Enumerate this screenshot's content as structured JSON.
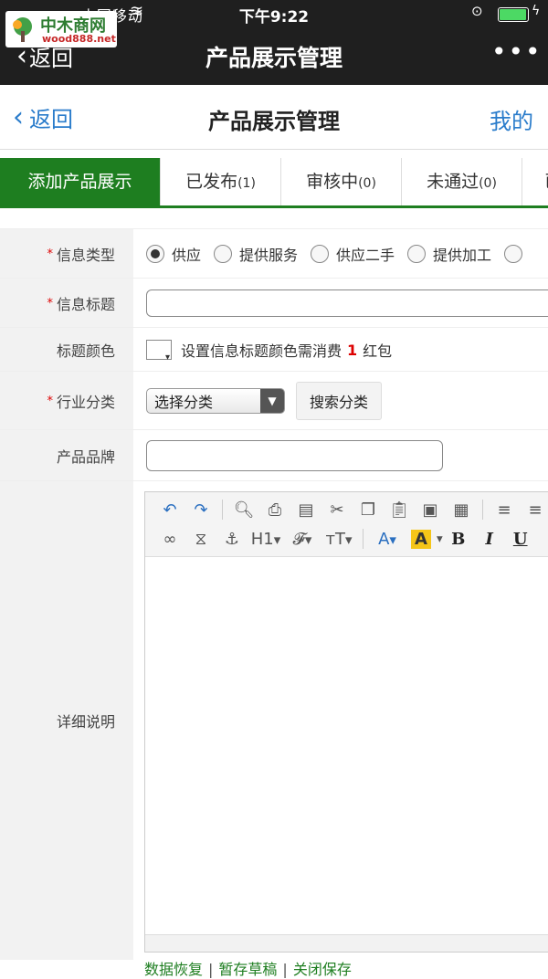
{
  "status": {
    "carrier": "●●●●● 中国移动",
    "time": "下午9:22"
  },
  "wechat": {
    "back": "返回",
    "title": "产品展示管理",
    "more": "•••"
  },
  "logo": {
    "cn": "中木商网",
    "en": "wood888.net"
  },
  "header": {
    "back": "返回",
    "title": "产品展示管理",
    "mine": "我的"
  },
  "tabs": [
    {
      "label": "添加产品展示",
      "count": ""
    },
    {
      "label": "已发布",
      "count": "(1)"
    },
    {
      "label": "审核中",
      "count": "(0)"
    },
    {
      "label": "未通过",
      "count": "(0)"
    },
    {
      "label": "已",
      "count": ""
    }
  ],
  "form": {
    "type_label": "信息类型",
    "type_options": [
      "供应",
      "提供服务",
      "供应二手",
      "提供加工"
    ],
    "title_label": "信息标题",
    "title_value": "",
    "color_label": "标题颜色",
    "color_text_pre": "设置信息标题颜色需消费",
    "color_cost": "1",
    "color_text_post": "红包",
    "industry_label": "行业分类",
    "industry_select": "选择分类",
    "industry_search": "搜索分类",
    "brand_label": "产品品牌",
    "brand_value": "",
    "detail_label": "详细说明",
    "required_mark": "*"
  },
  "editor": {
    "toolbar_row2": {
      "heading": "H1",
      "font": "𝓕",
      "size": "тT",
      "color": "A",
      "highlight": "A",
      "bold": "B",
      "italic": "I",
      "underline": "U"
    }
  },
  "footer_links": [
    "数据恢复",
    "暂存草稿",
    "关闭保存"
  ]
}
